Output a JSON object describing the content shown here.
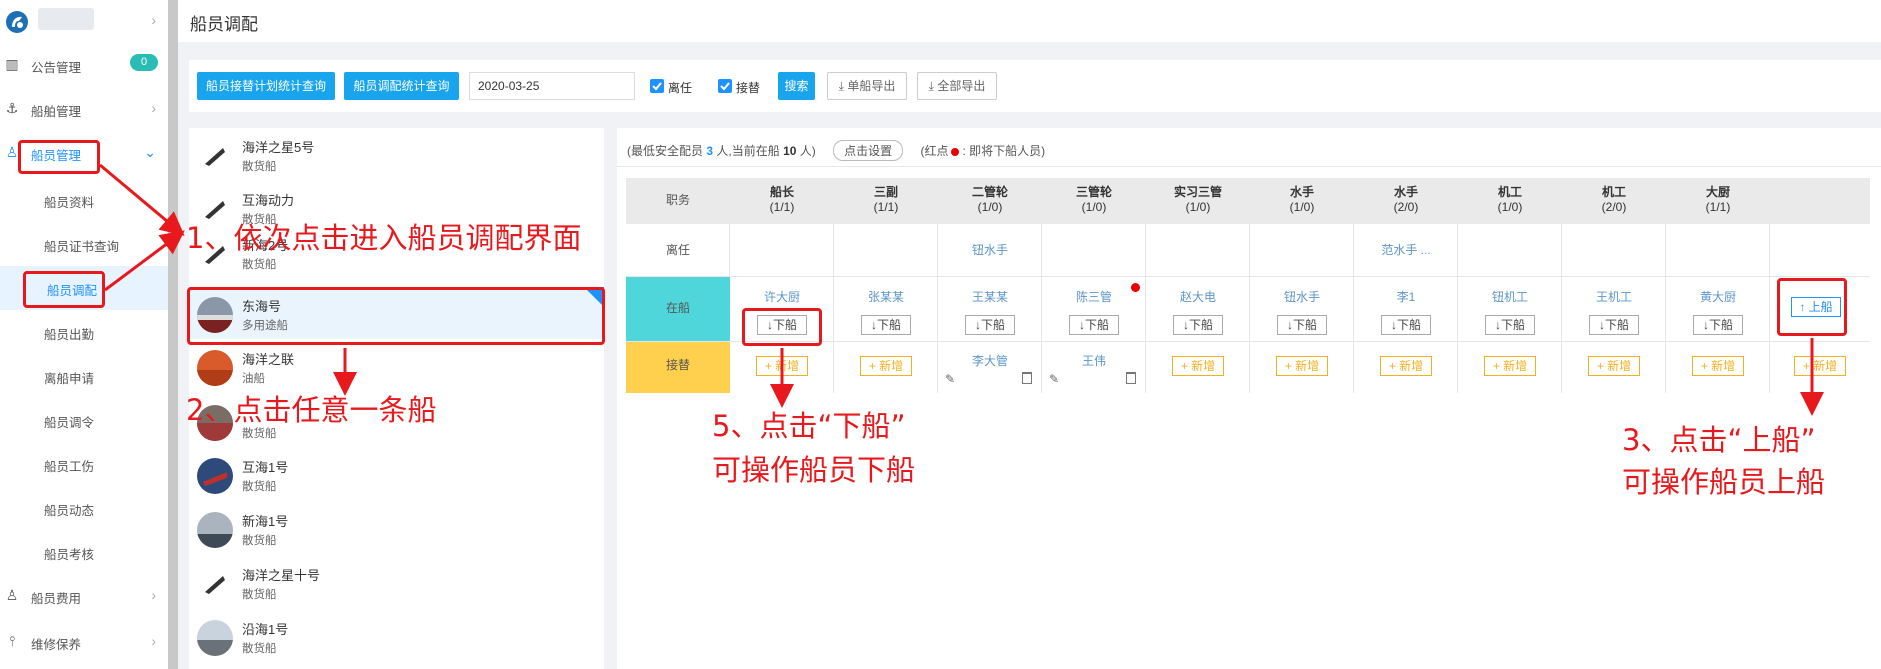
{
  "header": {
    "title": "船员调配"
  },
  "sidebar": {
    "notice_badge": "0",
    "items": [
      {
        "label": "公告管理",
        "icon": "book-icon"
      },
      {
        "label": "船舶管理",
        "icon": "anchor-icon"
      },
      {
        "label": "船员管理",
        "icon": "user-icon"
      },
      {
        "label": "船员资料"
      },
      {
        "label": "船员证书查询"
      },
      {
        "label": "船员调配"
      },
      {
        "label": "船员出勤"
      },
      {
        "label": "离船申请"
      },
      {
        "label": "船员调令"
      },
      {
        "label": "船员工伤"
      },
      {
        "label": "船员动态"
      },
      {
        "label": "船员考核"
      },
      {
        "label": "船员费用",
        "icon": "user-icon"
      },
      {
        "label": "维修保养",
        "icon": "wrench-icon"
      }
    ]
  },
  "toolbar": {
    "btn_plan": "船员接替计划统计查询",
    "btn_alloc": "船员调配统计查询",
    "date": "2020-03-25",
    "chk_leave": "离任",
    "chk_replace": "接替",
    "search": "搜索",
    "export_single": "单船导出",
    "export_all": "全部导出"
  },
  "ships": [
    {
      "name": "海洋之星5号",
      "type": "散货船"
    },
    {
      "name": "互海动力",
      "type": "散货船"
    },
    {
      "name": "新海2号",
      "type": "散货船"
    },
    {
      "name": "东海号",
      "type": "多用途船"
    },
    {
      "name": "海洋之联",
      "type": "油船"
    },
    {
      "name": "互海…",
      "type": "散货船"
    },
    {
      "name": "互海1号",
      "type": "散货船"
    },
    {
      "name": "新海1号",
      "type": "散货船"
    },
    {
      "name": "海洋之星十号",
      "type": "散货船"
    },
    {
      "name": "沿海1号",
      "type": "散货船"
    }
  ],
  "info": {
    "p1": "(最低安全配员",
    "min_crew": "3",
    "p2": "人,当前在船",
    "onboard": "10",
    "p3": "人)",
    "set_btn": "点击设置",
    "p4": "(红点",
    "p5": ": 即将下船人员)"
  },
  "grid": {
    "row_labels": {
      "header": "职务",
      "leave": "离任",
      "onboard": "在船",
      "replace": "接替"
    },
    "down_label": "↓下船",
    "add_label": "+ 新增",
    "up_label": "↑ 上船",
    "columns": [
      {
        "title": "船长",
        "count": "(1/1)",
        "leave": "",
        "onboard": "许大厨",
        "replace": ""
      },
      {
        "title": "三副",
        "count": "(1/1)",
        "leave": "",
        "onboard": "张某某",
        "replace": ""
      },
      {
        "title": "二管轮",
        "count": "(1/0)",
        "leave": "钮水手",
        "onboard": "王某某",
        "replace": "李大管"
      },
      {
        "title": "三管轮",
        "count": "(1/0)",
        "leave": "",
        "onboard": "陈三管",
        "replace": "王伟"
      },
      {
        "title": "实习三管",
        "count": "(1/0)",
        "leave": "",
        "onboard": "赵大电",
        "replace": ""
      },
      {
        "title": "水手",
        "count": "(1/0)",
        "leave": "",
        "onboard": "钮水手",
        "replace": ""
      },
      {
        "title": "水手",
        "count": "(2/0)",
        "leave": "范水手 ...",
        "onboard": "李1",
        "replace": ""
      },
      {
        "title": "机工",
        "count": "(1/0)",
        "leave": "",
        "onboard": "钮机工",
        "replace": ""
      },
      {
        "title": "机工",
        "count": "(2/0)",
        "leave": "",
        "onboard": "王机工",
        "replace": ""
      },
      {
        "title": "大厨",
        "count": "(1/1)",
        "leave": "",
        "onboard": "黄大厨",
        "replace": ""
      }
    ]
  },
  "annotations": {
    "a1": "1、依次点击进入船员调配界面",
    "a2": "2、点击任意一条船",
    "a5_l1": "5、点击“下船”",
    "a5_l2": "可操作船员下船",
    "a3_l1": "3、点击“上船”",
    "a3_l2": "可操作船员上船"
  },
  "colors": {
    "accent": "#1f92ff",
    "red": "#e8191c",
    "onboard_row": "#4fd6da",
    "replace_row": "#ffd04d",
    "add_orange": "#f5b021"
  }
}
